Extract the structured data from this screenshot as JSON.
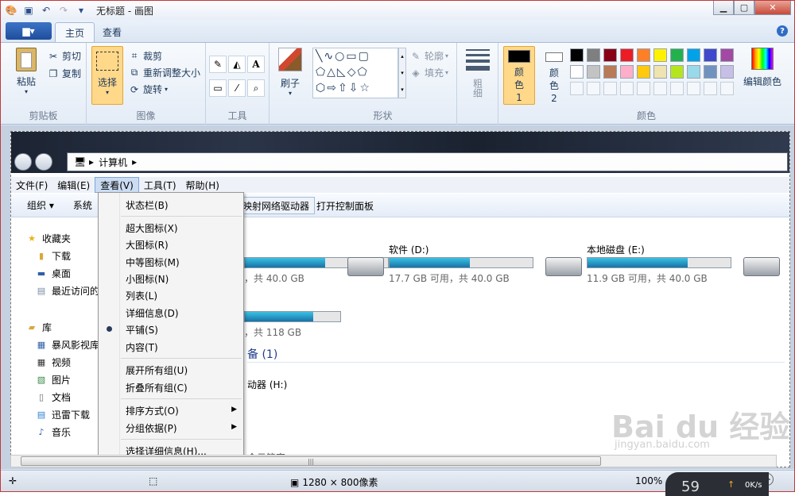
{
  "window": {
    "title": "无标题 - 画图"
  },
  "ribbon_tabs": {
    "file_label": "▆▾",
    "home": "主页",
    "view": "查看",
    "help": "?"
  },
  "clipboard": {
    "paste": "粘贴",
    "cut": "剪切",
    "copy": "复制",
    "group": "剪贴板"
  },
  "image": {
    "select": "选择",
    "crop": "裁剪",
    "resize": "重新调整大小",
    "rotate": "旋转",
    "group": "图像"
  },
  "tools": {
    "group": "工具",
    "text_icon": "A"
  },
  "brushes": {
    "label": "刷子"
  },
  "shapes": {
    "outline": "轮廓",
    "fill": "填充",
    "group": "形状"
  },
  "size": {
    "label": "粗细"
  },
  "colors": {
    "color1": "颜色 1",
    "color2": "颜色 2",
    "edit": "编辑颜色",
    "group": "颜色",
    "palette_row1": [
      "#000000",
      "#7f7f7f",
      "#880015",
      "#ed1c24",
      "#ff7f27",
      "#fff200",
      "#22b14c",
      "#00a2e8",
      "#3f48cc",
      "#a349a4"
    ],
    "palette_row2": [
      "#ffffff",
      "#c3c3c3",
      "#b97a57",
      "#ffaec9",
      "#ffc90e",
      "#efe4b0",
      "#b5e61d",
      "#99d9ea",
      "#7092be",
      "#c8bfe7"
    ]
  },
  "explorer": {
    "address": "计算机",
    "menus": [
      "文件(F)",
      "编辑(E)",
      "查看(V)",
      "工具(T)",
      "帮助(H)"
    ],
    "cmd_organize": "组织 ▾",
    "cmd_system": "系统",
    "cmd_netdrive": "映射网络驱动器",
    "cmd_cpl": "打开控制面板",
    "nav": {
      "favorites": "收藏夹",
      "downloads": "下载",
      "desktop": "桌面",
      "recent": "最近访问的",
      "library": "库",
      "storm": "暴风影视库",
      "videos": "视频",
      "pictures": "图片",
      "docs": "文档",
      "xunlei": "迅雷下载",
      "music": "音乐"
    },
    "drives": [
      {
        "name": "",
        "free": "，共 40.0 GB",
        "fill": 0.56
      },
      {
        "name": "软件 (D:)",
        "free": "17.7 GB 可用，共 40.0 GB",
        "fill": 0.56
      },
      {
        "name": "本地磁盘 (E:)",
        "free": "11.9 GB 可用，共 40.0 GB",
        "fill": 0.7
      },
      {
        "name": "",
        "free": "，共 118 GB",
        "fill": 0.72
      }
    ],
    "devices_header": "备 (1)",
    "dvd": "动器 (H:)",
    "guard": "全云管家"
  },
  "view_menu": {
    "status_bar": "状态栏(B)",
    "xl_icons": "超大图标(X)",
    "large_icons": "大图标(R)",
    "medium_icons": "中等图标(M)",
    "small_icons": "小图标(N)",
    "list": "列表(L)",
    "details": "详细信息(D)",
    "tiles": "平铺(S)",
    "content": "内容(T)",
    "expand_all": "展开所有组(U)",
    "collapse_all": "折叠所有组(C)",
    "sort_by": "排序方式(O)",
    "group_by": "分组依据(P)",
    "choose_details": "选择详细信息(H)..."
  },
  "status": {
    "dims": "1280 × 800像素",
    "zoom": "100%",
    "speed": "0K/s",
    "meter": "59"
  },
  "watermark": {
    "logo": "Bai du 经验",
    "url": "jingyan.baidu.com"
  }
}
